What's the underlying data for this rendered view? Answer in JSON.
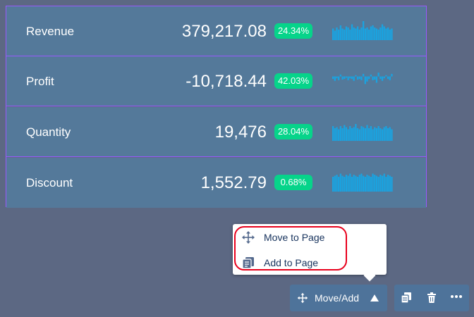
{
  "kpis": [
    {
      "label": "Revenue",
      "value": "379,217.08",
      "change": "24.34%",
      "spark": [
        0.55,
        0.45,
        0.6,
        0.5,
        0.7,
        0.55,
        0.5,
        0.65,
        0.6,
        0.5,
        0.75,
        0.6,
        0.55,
        0.65,
        0.5,
        0.6,
        0.9,
        0.55,
        0.6,
        0.5,
        0.65,
        0.7,
        0.6,
        0.55,
        0.5,
        0.6,
        0.75,
        0.65,
        0.55,
        0.6,
        0.5,
        0.55
      ]
    },
    {
      "label": "Profit",
      "value": "-10,718.44",
      "change": "42.03%",
      "spark": [
        -0.2,
        -0.35,
        -0.15,
        -0.3,
        0.15,
        -0.25,
        -0.2,
        -0.1,
        -0.3,
        -0.15,
        -0.2,
        -0.35,
        0.1,
        -0.25,
        -0.2,
        -0.3,
        0.2,
        -0.6,
        -0.4,
        -0.2,
        0.15,
        -0.3,
        -0.25,
        -0.5,
        0.3,
        -0.2,
        -0.35,
        -0.15,
        0.1,
        -0.2,
        -0.3,
        0.2
      ]
    },
    {
      "label": "Quantity",
      "value": "19,476",
      "change": "28.04%",
      "spark": [
        0.7,
        0.6,
        0.65,
        0.55,
        0.7,
        0.6,
        0.75,
        0.65,
        0.55,
        0.7,
        0.6,
        0.65,
        0.8,
        0.6,
        0.55,
        0.7,
        0.65,
        0.6,
        0.75,
        0.6,
        0.7,
        0.55,
        0.65,
        0.6,
        0.7,
        0.6,
        0.55,
        0.65,
        0.7,
        0.6,
        0.65,
        0.55
      ]
    },
    {
      "label": "Discount",
      "value": "1,552.79",
      "change": "0.68%",
      "spark": [
        0.7,
        0.75,
        0.8,
        0.7,
        0.85,
        0.75,
        0.7,
        0.8,
        0.75,
        0.85,
        0.7,
        0.8,
        0.75,
        0.7,
        0.8,
        0.85,
        0.75,
        0.7,
        0.8,
        0.75,
        0.7,
        0.85,
        0.8,
        0.75,
        0.7,
        0.8,
        0.75,
        0.85,
        0.7,
        0.8,
        0.75,
        0.7
      ]
    }
  ],
  "popover": {
    "items": [
      {
        "label": "Move to Page",
        "icon": "move-icon"
      },
      {
        "label": "Add to Page",
        "icon": "add-page-icon"
      }
    ]
  },
  "toolbar": {
    "move_add_label": "Move/Add",
    "icons": [
      "move-icon",
      "caret-up-icon",
      "copy-icon",
      "trash-icon",
      "more-icon"
    ]
  },
  "colors": {
    "background": "#5c6883",
    "row": "#54799a",
    "row_border": "#9a57ff",
    "badge": "#06d48a",
    "sparkline": "#1aa3e0",
    "highlight": "#e8001c",
    "button": "#4e739a"
  }
}
